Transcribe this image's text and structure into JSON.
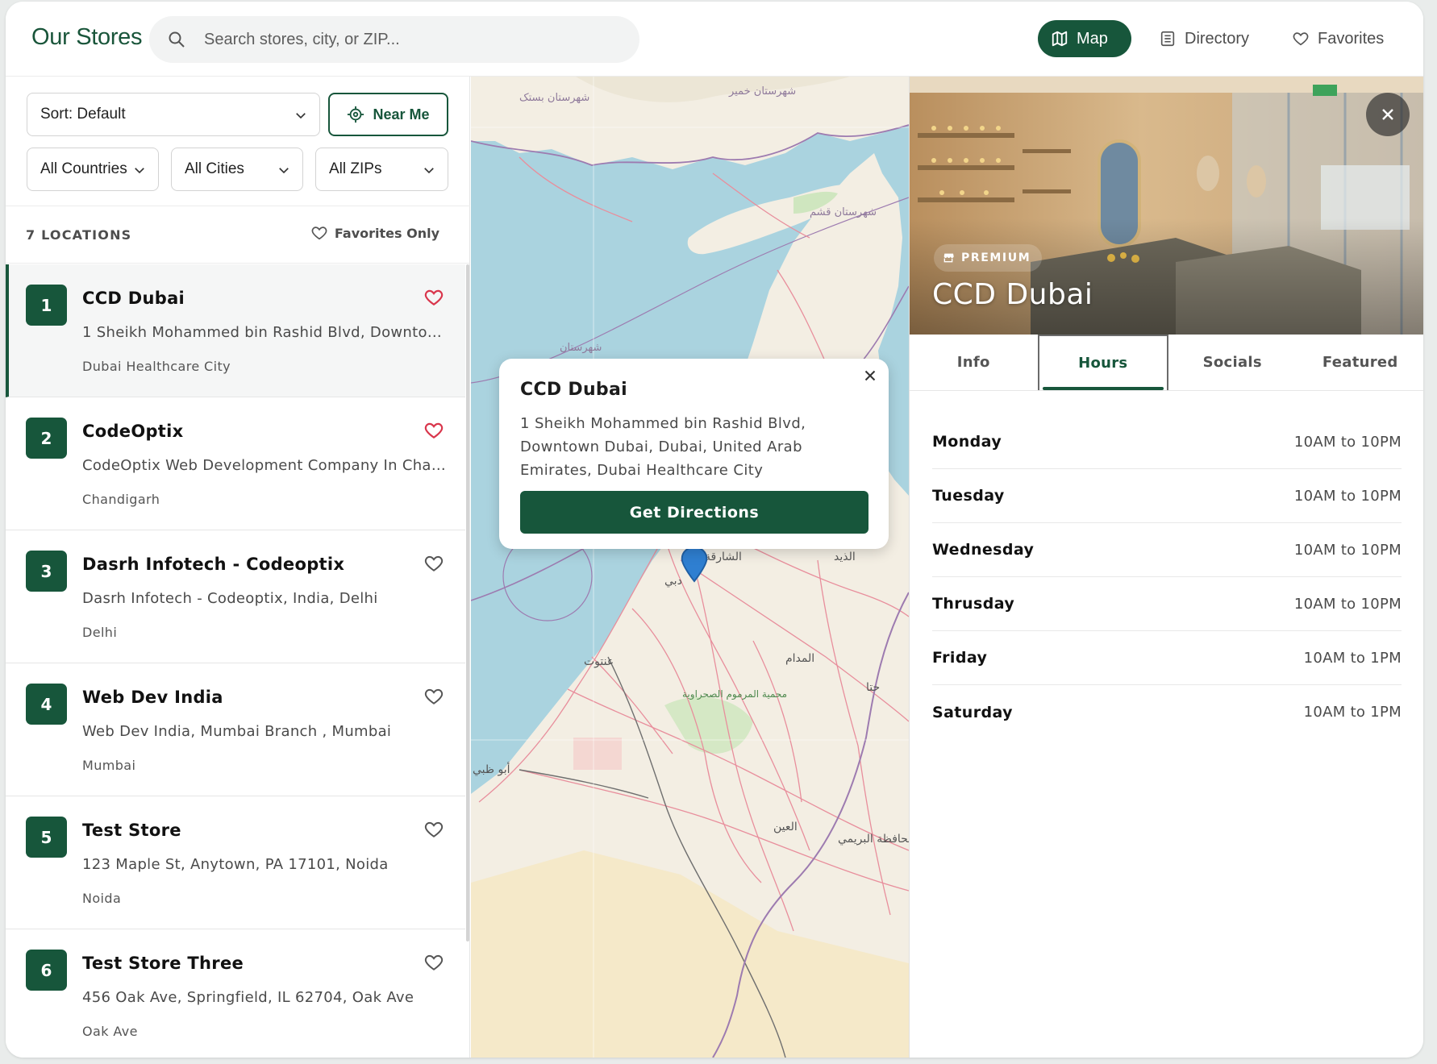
{
  "header": {
    "brand": "Our Stores",
    "search_placeholder": "Search stores, city, or ZIP...",
    "nav": {
      "map": "Map",
      "directory": "Directory",
      "favorites": "Favorites"
    },
    "active_nav": "map"
  },
  "filters": {
    "sort": "Sort: Default",
    "near_me": "Near Me",
    "country": "All Countries",
    "city": "All Cities",
    "zip": "All ZIPs"
  },
  "list": {
    "count_label": "7 LOCATIONS",
    "favorites_only": "Favorites Only",
    "stores": [
      {
        "num": "1",
        "name": "CCD Dubai",
        "address": "1 Sheikh Mohammed bin Rashid Blvd, Downtown...",
        "city": "Dubai Healthcare City",
        "favorite": true,
        "active": true
      },
      {
        "num": "2",
        "name": "CodeOptix",
        "address": "CodeOptix Web Development Company In Chand...",
        "city": "Chandigarh",
        "favorite": true,
        "active": false
      },
      {
        "num": "3",
        "name": "Dasrh Infotech - Codeoptix",
        "address": "Dasrh Infotech - Codeoptix, India, Delhi",
        "city": "Delhi",
        "favorite": false,
        "active": false
      },
      {
        "num": "4",
        "name": "Web Dev India",
        "address": "Web Dev India, Mumbai Branch , Mumbai",
        "city": "Mumbai",
        "favorite": false,
        "active": false
      },
      {
        "num": "5",
        "name": "Test Store",
        "address": "123 Maple St, Anytown, PA 17101, Noida",
        "city": "Noida",
        "favorite": false,
        "active": false
      },
      {
        "num": "6",
        "name": "Test Store Three",
        "address": "456 Oak Ave, Springfield, IL 62704, Oak Ave",
        "city": "Oak Ave",
        "favorite": false,
        "active": false
      }
    ]
  },
  "map": {
    "labels": [
      "شهرستان بستک",
      "شهرستان خمیر",
      "شهرستان قشم",
      "شهرستان",
      "الشارقة",
      "دبي",
      "عنتوت",
      "محمية المرموم الصحراوية",
      "المدام",
      "أبو ظبي",
      "العين",
      "محافظة البريمي",
      "الذيد",
      "حتا"
    ],
    "popup": {
      "title": "CCD Dubai",
      "address": "1 Sheikh Mohammed bin Rashid Blvd, Downtown Dubai, Dubai, United Arab Emirates, Dubai Healthcare City",
      "button": "Get Directions"
    }
  },
  "detail": {
    "badge": "PREMIUM",
    "title": "CCD Dubai",
    "tabs": [
      "Info",
      "Hours",
      "Socials",
      "Featured"
    ],
    "active_tab": "Hours",
    "hours": [
      {
        "day": "Monday",
        "time": "10AM to 10PM"
      },
      {
        "day": "Tuesday",
        "time": "10AM to 10PM"
      },
      {
        "day": "Wednesday",
        "time": "10AM to 10PM"
      },
      {
        "day": "Thrusday",
        "time": "10AM to 10PM"
      },
      {
        "day": "Friday",
        "time": "10AM to 1PM"
      },
      {
        "day": "Saturday",
        "time": "10AM to 1PM"
      }
    ]
  },
  "colors": {
    "brand": "#17563b",
    "heart_active": "#d9364c",
    "water": "#aad3df",
    "land": "#f3eee3"
  }
}
